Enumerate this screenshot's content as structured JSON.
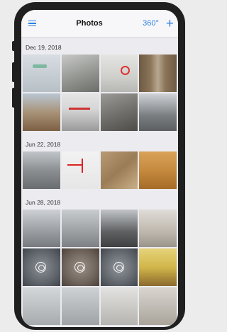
{
  "navbar": {
    "title": "Photos",
    "view360": "360°",
    "add": "+"
  },
  "sections": [
    {
      "date": "Dec 19, 2018"
    },
    {
      "date": "Jun 22, 2018"
    },
    {
      "date": "Jun 28, 2018"
    }
  ],
  "colors": {
    "accent": "#2f7fe0"
  }
}
